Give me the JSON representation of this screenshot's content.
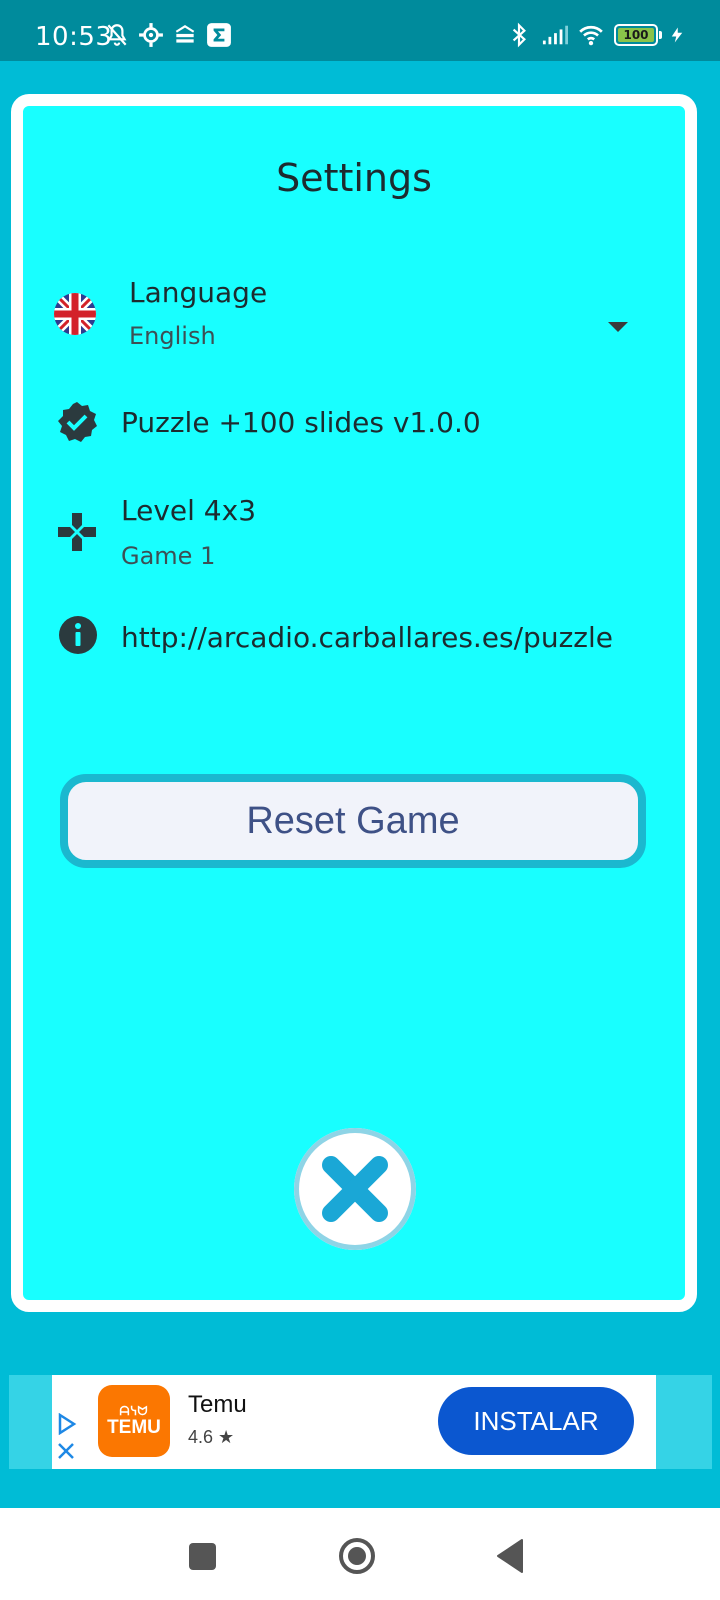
{
  "status_bar": {
    "time": "10:53",
    "battery": "100"
  },
  "settings": {
    "title": "Settings",
    "language": {
      "label": "Language",
      "value": "English"
    },
    "version": {
      "label": "Puzzle +100 slides v1.0.0"
    },
    "level": {
      "label": "Level 4x3",
      "subtitle": "Game 1"
    },
    "info": {
      "url": "http://arcadio.carballares.es/puzzle"
    },
    "reset_label": "Reset Game"
  },
  "ad": {
    "logo_text": "TEMU",
    "logo_top": "ᗩᓭᗢ",
    "app_name": "Temu",
    "rating": "4.6 ★",
    "install_label": "INSTALAR"
  },
  "colors": {
    "card_background": "#18ffff",
    "app_background": "#00bcd6",
    "status_bar": "#008b9c",
    "reset_text": "#3e5186",
    "close_x": "#1aa7d6",
    "install_button": "#0b57d0",
    "temu_orange": "#fb7701"
  }
}
